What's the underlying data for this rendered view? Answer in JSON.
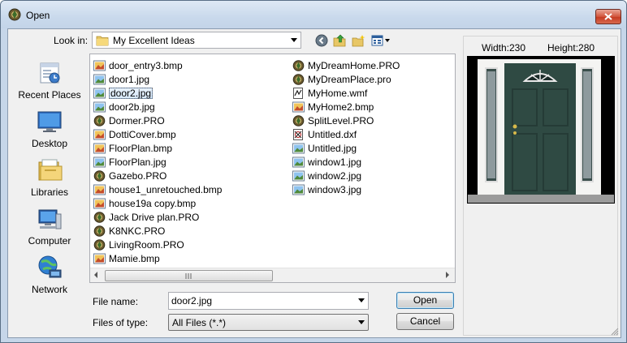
{
  "window": {
    "title": "Open"
  },
  "lookin": {
    "label": "Look in:",
    "value": "My Excellent Ideas"
  },
  "places": [
    {
      "key": "recent",
      "label": "Recent Places",
      "icon": "recent-places-icon"
    },
    {
      "key": "desktop",
      "label": "Desktop",
      "icon": "desktop-icon"
    },
    {
      "key": "libraries",
      "label": "Libraries",
      "icon": "libraries-icon"
    },
    {
      "key": "computer",
      "label": "Computer",
      "icon": "computer-icon"
    },
    {
      "key": "network",
      "label": "Network",
      "icon": "network-icon"
    }
  ],
  "files": {
    "col1": [
      {
        "name": "door_entry3.bmp",
        "type": "bmp"
      },
      {
        "name": "door1.jpg",
        "type": "jpg"
      },
      {
        "name": "door2.jpg",
        "type": "jpg",
        "selected": true
      },
      {
        "name": "door2b.jpg",
        "type": "jpg"
      },
      {
        "name": "Dormer.PRO",
        "type": "pro"
      },
      {
        "name": "DottiCover.bmp",
        "type": "bmp"
      },
      {
        "name": "FloorPlan.bmp",
        "type": "bmp"
      },
      {
        "name": "FloorPlan.jpg",
        "type": "jpg"
      },
      {
        "name": "Gazebo.PRO",
        "type": "pro"
      },
      {
        "name": "house1_unretouched.bmp",
        "type": "bmp"
      },
      {
        "name": "house19a copy.bmp",
        "type": "bmp"
      },
      {
        "name": "Jack Drive plan.PRO",
        "type": "pro"
      },
      {
        "name": "K8NKC.PRO",
        "type": "pro"
      },
      {
        "name": "LivingRoom.PRO",
        "type": "pro"
      },
      {
        "name": "Mamie.bmp",
        "type": "bmp"
      }
    ],
    "col2": [
      {
        "name": "MyDreamHome.PRO",
        "type": "pro"
      },
      {
        "name": "MyDreamPlace.pro",
        "type": "pro"
      },
      {
        "name": "MyHome.wmf",
        "type": "wmf"
      },
      {
        "name": "MyHome2.bmp",
        "type": "bmp"
      },
      {
        "name": "SplitLevel.PRO",
        "type": "pro"
      },
      {
        "name": "Untitled.dxf",
        "type": "dxf"
      },
      {
        "name": "Untitled.jpg",
        "type": "jpg"
      },
      {
        "name": "window1.jpg",
        "type": "jpg"
      },
      {
        "name": "window2.jpg",
        "type": "jpg"
      },
      {
        "name": "window3.jpg",
        "type": "jpg"
      }
    ]
  },
  "filename": {
    "label": "File name:",
    "value": "door2.jpg"
  },
  "filetype": {
    "label": "Files of type:",
    "value": "All Files (*.*)"
  },
  "buttons": {
    "open": "Open",
    "cancel": "Cancel"
  },
  "preview": {
    "width_label": "Width:230",
    "height_label": "Height:280"
  },
  "colors": {
    "accent": "#3c7fb1",
    "door": "#2f4a43"
  }
}
